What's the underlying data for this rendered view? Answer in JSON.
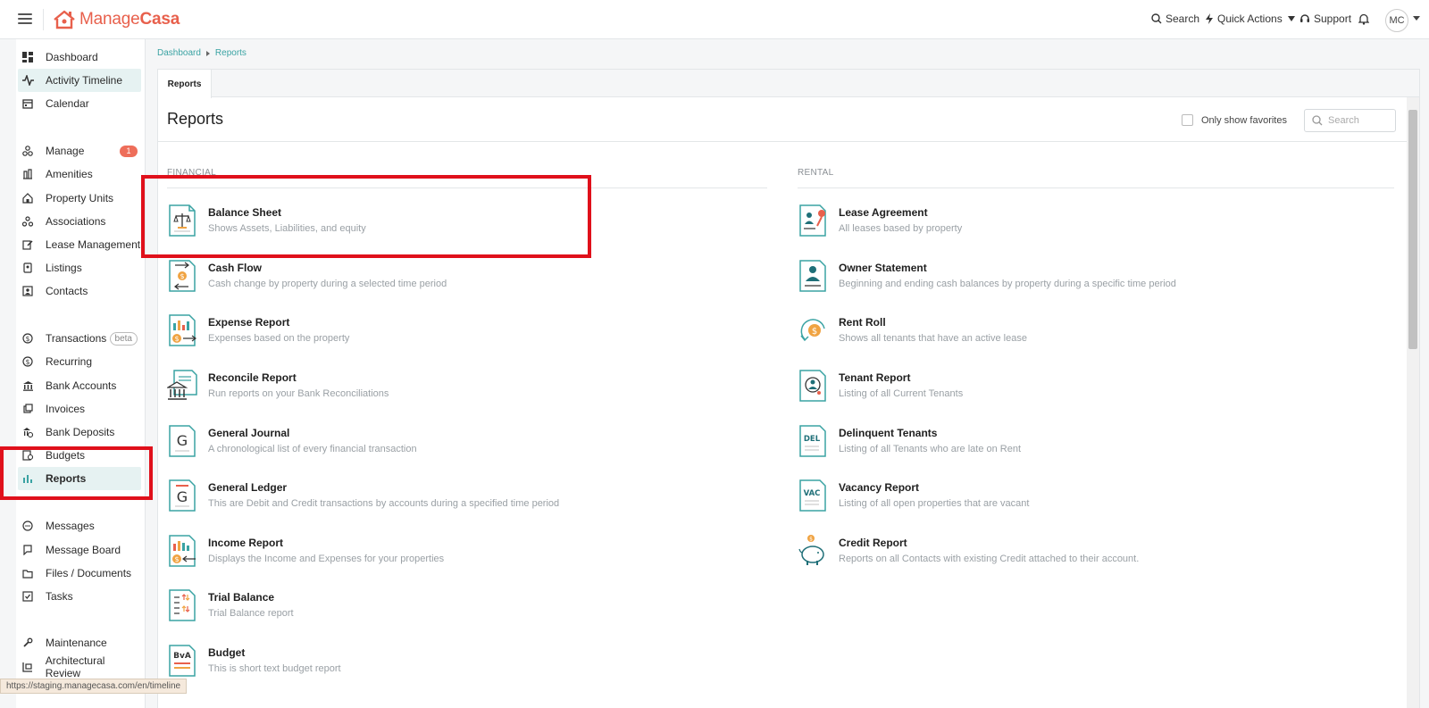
{
  "app": {
    "logo_text_light": "Manage",
    "logo_text_bold": "Casa",
    "brand_color": "#e8604c",
    "accent_color": "#3aa3a3"
  },
  "topbar": {
    "search": "Search",
    "quick_actions": "Quick Actions",
    "support": "Support",
    "avatar": "MC"
  },
  "sidebar": {
    "dashboard": "Dashboard",
    "activity_timeline": "Activity Timeline",
    "calendar": "Calendar",
    "manage": "Manage",
    "manage_badge": "1",
    "amenities": "Amenities",
    "property_units": "Property Units",
    "associations": "Associations",
    "lease_management": "Lease Management",
    "listings": "Listings",
    "contacts": "Contacts",
    "transactions": "Transactions",
    "transactions_badge": "beta",
    "recurring": "Recurring",
    "bank_accounts": "Bank Accounts",
    "invoices": "Invoices",
    "bank_deposits": "Bank Deposits",
    "budgets": "Budgets",
    "reports": "Reports",
    "messages": "Messages",
    "message_board": "Message Board",
    "files_documents": "Files / Documents",
    "tasks": "Tasks",
    "maintenance": "Maintenance",
    "architectural_review": "Architectural Review"
  },
  "breadcrumb": {
    "dashboard": "Dashboard",
    "current": "Reports"
  },
  "page": {
    "tab": "Reports",
    "title": "Reports",
    "only_favorites": "Only show favorites",
    "search_placeholder": "Search"
  },
  "financial": {
    "title": "FINANCIAL",
    "reports": [
      {
        "name": "Balance Sheet",
        "desc": "Shows Assets, Liabilities, and equity"
      },
      {
        "name": "Cash Flow",
        "desc": "Cash change by property during a selected time period"
      },
      {
        "name": "Expense Report",
        "desc": "Expenses based on the property"
      },
      {
        "name": "Reconcile Report",
        "desc": "Run reports on your Bank Reconciliations"
      },
      {
        "name": "General Journal",
        "desc": "A chronological list of every financial transaction"
      },
      {
        "name": "General Ledger",
        "desc": "This are Debit and Credit transactions by accounts during a specified time period"
      },
      {
        "name": "Income Report",
        "desc": "Displays the Income and Expenses for your properties"
      },
      {
        "name": "Trial Balance",
        "desc": "Trial Balance report"
      },
      {
        "name": "Budget",
        "desc": "This is short text budget report"
      }
    ]
  },
  "rental": {
    "title": "RENTAL",
    "reports": [
      {
        "name": "Lease Agreement",
        "desc": "All leases based by property"
      },
      {
        "name": "Owner Statement",
        "desc": "Beginning and ending cash balances by property during a specific time period"
      },
      {
        "name": "Rent Roll",
        "desc": "Shows all tenants that have an active lease"
      },
      {
        "name": "Tenant Report",
        "desc": "Listing of all Current Tenants"
      },
      {
        "name": "Delinquent Tenants",
        "desc": "Listing of all Tenants who are late on Rent"
      },
      {
        "name": "Vacancy Report",
        "desc": "Listing of all open properties that are vacant"
      },
      {
        "name": "Credit Report",
        "desc": "Reports on all Contacts with existing Credit attached to their account."
      }
    ]
  },
  "icon_labels": {
    "general_journal": "G",
    "general_ledger": "G",
    "budget": "BvA",
    "delinquent": "DEL",
    "vacancy": "VAC"
  },
  "status_bar": {
    "url": "https://staging.managecasa.com/en/timeline"
  }
}
